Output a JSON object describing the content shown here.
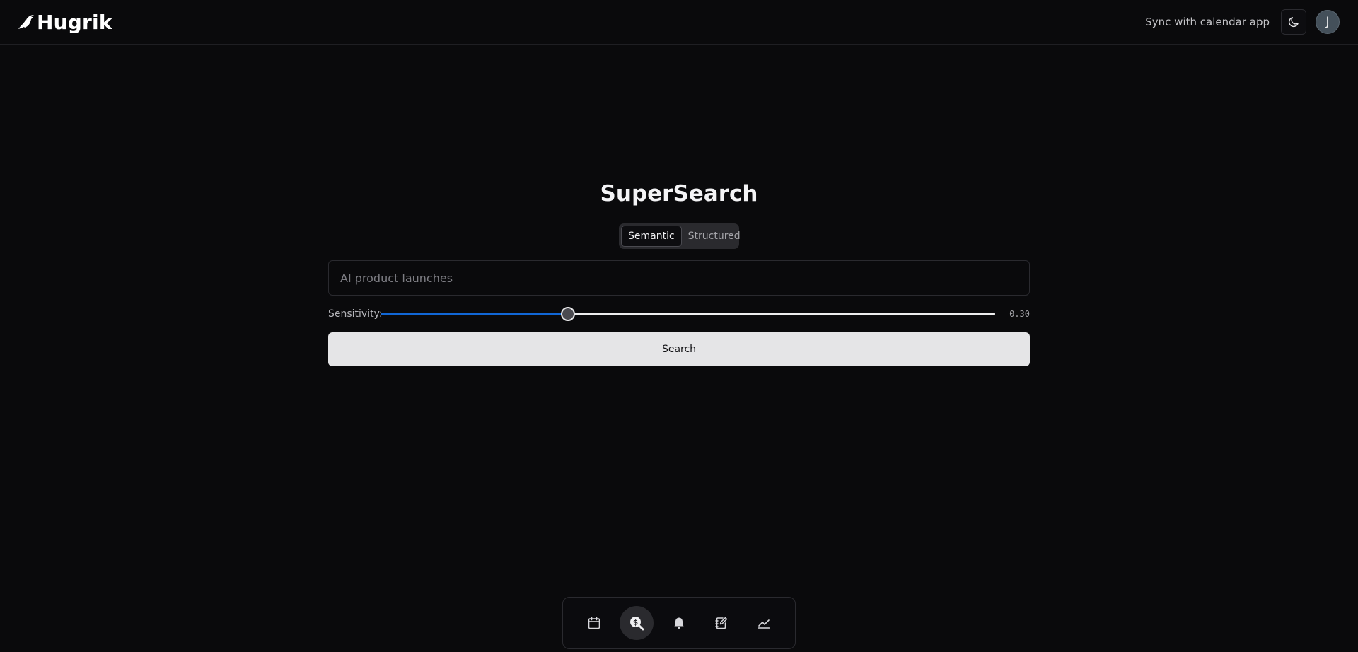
{
  "header": {
    "brand_name": "Hugrik",
    "brand_icon": "bird-logo-icon",
    "sync_label": "Sync with calendar app",
    "theme_icon": "moon-icon",
    "avatar_initial": "J"
  },
  "main": {
    "title": "SuperSearch",
    "modes": [
      {
        "label": "Semantic",
        "active": true
      },
      {
        "label": "Structured",
        "active": false
      }
    ],
    "search_placeholder": "AI product launches",
    "search_value": "",
    "sensitivity_label": "Sensitivity:",
    "sensitivity_value": 0.3,
    "sensitivity_display": "0.30",
    "search_button_label": "Search"
  },
  "dock": {
    "items": [
      {
        "icon": "calendar-icon",
        "active": false
      },
      {
        "icon": "search-dollar-icon",
        "active": true
      },
      {
        "icon": "bell-icon",
        "active": false
      },
      {
        "icon": "notebook-edit-icon",
        "active": false
      },
      {
        "icon": "trend-chart-icon",
        "active": false
      }
    ]
  },
  "colors": {
    "background": "#0a0a0c",
    "accent": "#1167d6",
    "button_bg": "#e5e5e7"
  }
}
